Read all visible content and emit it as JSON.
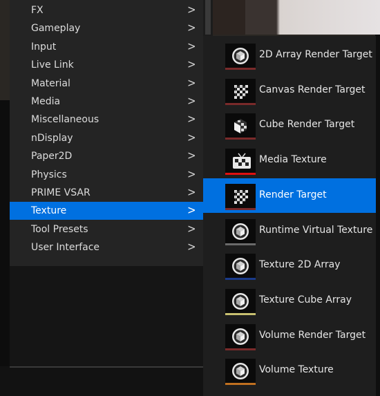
{
  "menu": {
    "items": [
      {
        "label": "FX",
        "selected": false
      },
      {
        "label": "Gameplay",
        "selected": false
      },
      {
        "label": "Input",
        "selected": false
      },
      {
        "label": "Live Link",
        "selected": false
      },
      {
        "label": "Material",
        "selected": false
      },
      {
        "label": "Media",
        "selected": false
      },
      {
        "label": "Miscellaneous",
        "selected": false
      },
      {
        "label": "nDisplay",
        "selected": false
      },
      {
        "label": "Paper2D",
        "selected": false
      },
      {
        "label": "Physics",
        "selected": false
      },
      {
        "label": "PRIME VSAR",
        "selected": false
      },
      {
        "label": "Texture",
        "selected": true
      },
      {
        "label": "Tool Presets",
        "selected": false
      },
      {
        "label": "User Interface",
        "selected": false
      }
    ],
    "submenu_chevron": ">"
  },
  "submenu": {
    "items": [
      {
        "label": "2D Array Render Target",
        "icon": "cube-icon",
        "bar_color": "#7a2a2a"
      },
      {
        "label": "Canvas Render Target",
        "icon": "checker-icon",
        "bar_color": "#7a2a2a"
      },
      {
        "label": "Cube Render Target",
        "icon": "checker-cube-icon",
        "bar_color": "#7a2a2a"
      },
      {
        "label": "Media Texture",
        "icon": "tv-icon",
        "bar_color": "#e01010"
      },
      {
        "label": "Render Target",
        "icon": "checker-icon",
        "bar_color": "#7a2a2a",
        "selected": true
      },
      {
        "label": "Runtime Virtual Texture",
        "icon": "cube-icon",
        "bar_color": "#6a6a6a"
      },
      {
        "label": "Texture 2D Array",
        "icon": "cube-icon",
        "bar_color": "#1a3a8a"
      },
      {
        "label": "Texture Cube Array",
        "icon": "cube-icon",
        "bar_color": "#c8c070"
      },
      {
        "label": "Volume Render Target",
        "icon": "cube-icon",
        "bar_color": "#7a2a2a"
      },
      {
        "label": "Volume Texture",
        "icon": "cube-icon",
        "bar_color": "#c07020"
      }
    ]
  }
}
